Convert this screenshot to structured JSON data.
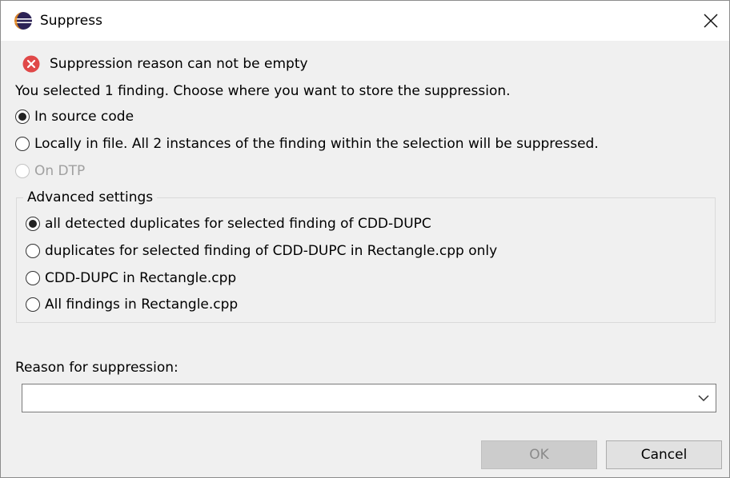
{
  "window": {
    "title": "Suppress",
    "app_icon": "eclipse-icon",
    "close_icon": "close-icon"
  },
  "error": {
    "icon": "error-icon",
    "color": "#e04848",
    "message": "Suppression reason can not be empty"
  },
  "instruction": "You selected 1 finding. Choose where you want to store the suppression.",
  "storage_options": [
    {
      "label": "In source code",
      "checked": true,
      "enabled": true
    },
    {
      "label": "Locally in file. All 2 instances of the finding within the selection will be suppressed.",
      "checked": false,
      "enabled": true
    },
    {
      "label": "On DTP",
      "checked": false,
      "enabled": false
    }
  ],
  "advanced": {
    "title": "Advanced settings",
    "options": [
      {
        "label": "all detected duplicates for selected finding of CDD-DUPC",
        "checked": true
      },
      {
        "label": "duplicates for selected finding of CDD-DUPC in Rectangle.cpp only",
        "checked": false
      },
      {
        "label": "CDD-DUPC in Rectangle.cpp",
        "checked": false
      },
      {
        "label": "All findings in Rectangle.cpp",
        "checked": false
      }
    ]
  },
  "reason": {
    "label": "Reason for suppression:",
    "value": "",
    "arrow_icon": "chevron-down-icon"
  },
  "buttons": {
    "ok": "OK",
    "ok_enabled": false,
    "cancel": "Cancel"
  }
}
